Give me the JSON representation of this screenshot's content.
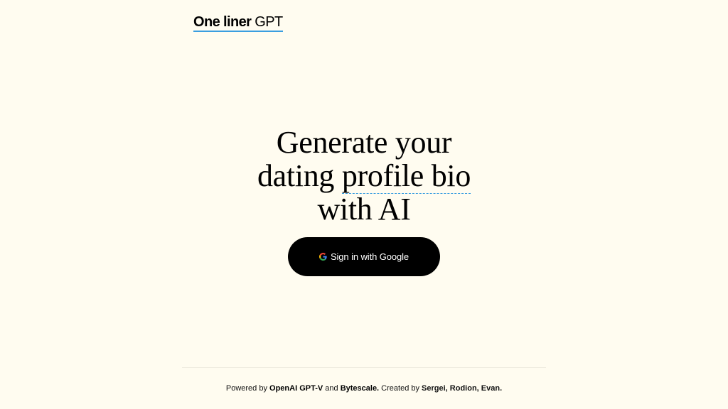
{
  "header": {
    "logo_bold": "One liner",
    "logo_regular": " GPT"
  },
  "hero": {
    "line1": "Generate your",
    "line2_pre": "dating ",
    "line2_highlight": "profile bio",
    "line3": "with AI"
  },
  "signin": {
    "icon": "google-icon",
    "label": "Sign in with Google",
    "background": "#000000",
    "text_color": "#ffffff"
  },
  "footer": {
    "prefix": "Powered by ",
    "link1": "OpenAI GPT-V",
    "mid1": " and ",
    "link2": "Bytescale.",
    "mid2": " Created by ",
    "authors": "Sergei, Rodion, Evan."
  },
  "colors": {
    "background": "#fffcf0",
    "accent": "#3a9ee0",
    "text": "#000000"
  }
}
